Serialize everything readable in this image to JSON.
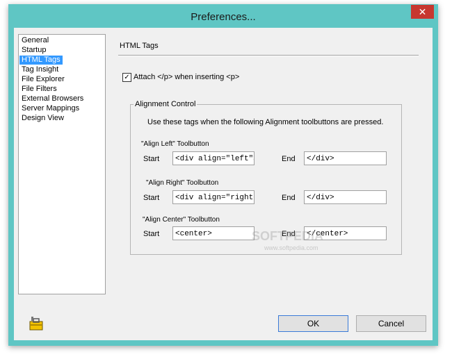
{
  "window": {
    "title": "Preferences...",
    "close_label": "✕"
  },
  "sidebar": {
    "items": [
      {
        "label": "General"
      },
      {
        "label": "Startup"
      },
      {
        "label": "HTML Tags",
        "selected": true
      },
      {
        "label": "Tag Insight"
      },
      {
        "label": "File Explorer"
      },
      {
        "label": "File Filters"
      },
      {
        "label": "External Browsers"
      },
      {
        "label": "Server Mappings"
      },
      {
        "label": "Design View"
      }
    ]
  },
  "section": {
    "title": "HTML Tags"
  },
  "attach_option": {
    "label": "Attach </p> when inserting <p>",
    "checked": true,
    "check_glyph": "✓"
  },
  "alignment_group": {
    "title": "Alignment Control",
    "instructions": "Use these tags when the following Alignment toolbuttons are pressed.",
    "start_label": "Start",
    "end_label": "End",
    "left": {
      "label": "\"Align Left\" Toolbutton",
      "start": "<div align=\"left\">",
      "end": "</div>"
    },
    "right": {
      "label": "\"Align Right\" Toolbutton",
      "start": "<div align=\"right\">",
      "end": "</div>"
    },
    "center": {
      "label": "\"Align Center\" Toolbutton",
      "start": "<center>",
      "end": "</center>"
    }
  },
  "watermark": {
    "text": "SOFTPEDIA",
    "url": "www.softpedia.com"
  },
  "buttons": {
    "ok": "OK",
    "cancel": "Cancel"
  },
  "icons": {
    "app": "toolbox-icon",
    "close": "close-icon",
    "check": "check-icon"
  },
  "colors": {
    "title_bar": "#5fc6c4",
    "selection": "#3399ff",
    "close": "#c7372f"
  }
}
